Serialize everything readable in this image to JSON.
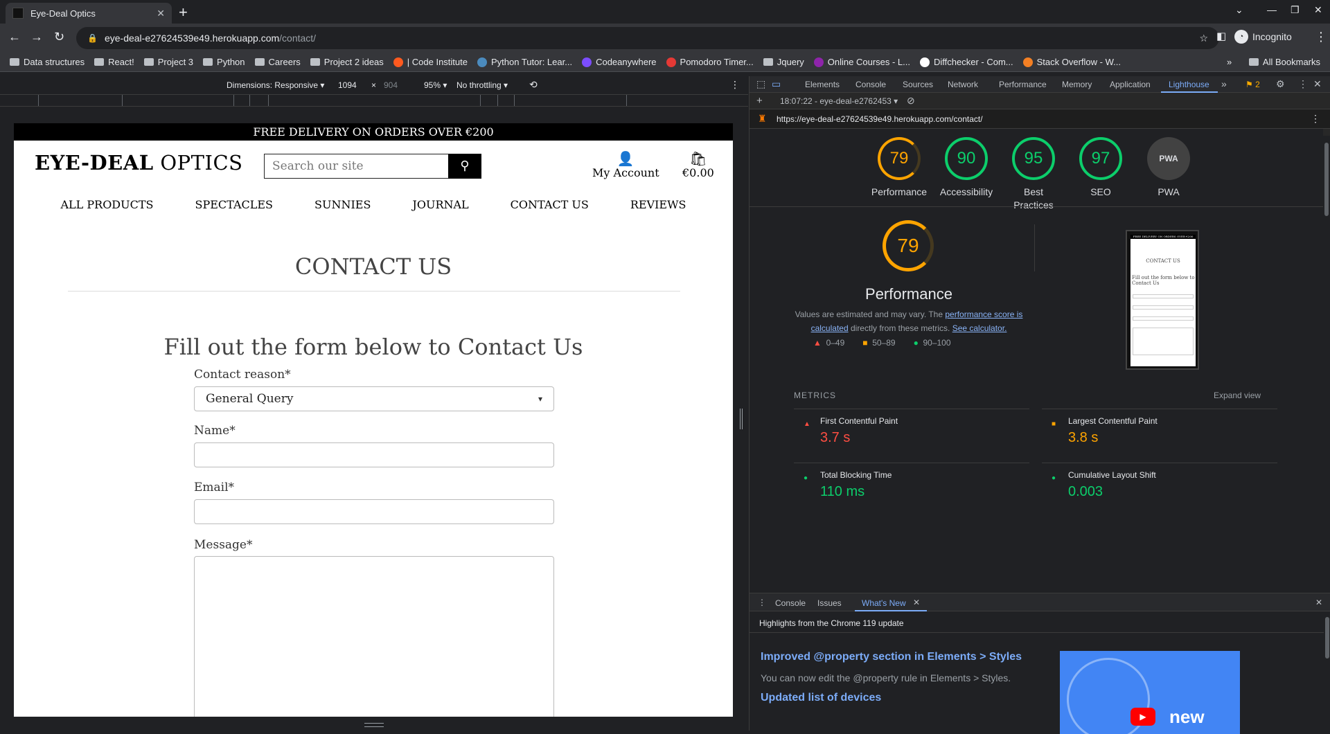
{
  "browser": {
    "tab_title": "Eye-Deal Optics",
    "new_tab": "+",
    "url_host": "eye-deal-e27624539e49.herokuapp.com",
    "url_path": "/contact/",
    "incognito_label": "Incognito",
    "bookmarks": [
      {
        "label": "Data structures",
        "icon": "folder-icon"
      },
      {
        "label": "React!",
        "icon": "folder-icon"
      },
      {
        "label": "Project 3",
        "icon": "folder-icon"
      },
      {
        "label": "Python",
        "icon": "folder-icon"
      },
      {
        "label": "Careers",
        "icon": "folder-icon"
      },
      {
        "label": "Project 2 ideas",
        "icon": "folder-icon"
      },
      {
        "label": "| Code Institute",
        "icon": "code-institute-icon"
      },
      {
        "label": "Python Tutor: Lear...",
        "icon": "python-icon"
      },
      {
        "label": "Codeanywhere",
        "icon": "codeanywhere-icon"
      },
      {
        "label": "Pomodoro Timer...",
        "icon": "pomodoro-icon"
      },
      {
        "label": "Jquery",
        "icon": "folder-icon"
      },
      {
        "label": "Online Courses - L...",
        "icon": "courses-icon"
      },
      {
        "label": "Diffchecker - Com...",
        "icon": "diffchecker-icon"
      },
      {
        "label": "Stack Overflow - W...",
        "icon": "stackoverflow-icon"
      }
    ],
    "all_bookmarks": "All Bookmarks"
  },
  "device_toolbar": {
    "dimensions": "Dimensions: Responsive",
    "width": "1094",
    "times": "×",
    "height": "904",
    "zoom": "95%",
    "throttling": "No throttling"
  },
  "site": {
    "promo": "FREE DELIVERY ON ORDERS OVER €200",
    "logo_bold": "EYE-DEAL",
    "logo_light": " OPTICS",
    "search_placeholder": "Search our site",
    "account": "My Account",
    "bag_total": "€0.00",
    "nav": [
      "ALL PRODUCTS",
      "SPECTACLES",
      "SUNNIES",
      "JOURNAL",
      "CONTACT US",
      "REVIEWS"
    ],
    "page_title": "CONTACT US",
    "form_title": "Fill out the form below to Contact Us",
    "contact_reason_label": "Contact reason*",
    "contact_reason_value": "General Query",
    "name_label": "Name*",
    "email_label": "Email*",
    "message_label": "Message*"
  },
  "devtools": {
    "tabs": [
      "Elements",
      "Console",
      "Sources",
      "Network",
      "Performance",
      "Memory",
      "Application",
      "Lighthouse"
    ],
    "more": "»",
    "issues_count": "2",
    "report_select": "18:07:22 - eye-deal-e2762453",
    "report_url": "https://eye-deal-e27624539e49.herokuapp.com/contact/",
    "scores": [
      {
        "label": "Performance",
        "value": "79",
        "status": "orange"
      },
      {
        "label": "Accessibility",
        "value": "90",
        "status": "green"
      },
      {
        "label": "Best Practices",
        "value": "95",
        "status": "green"
      },
      {
        "label": "SEO",
        "value": "97",
        "status": "green"
      },
      {
        "label": "PWA",
        "value": "PWA",
        "status": "gray"
      }
    ],
    "perf_score": "79",
    "perf_title": "Performance",
    "perf_note_1": "Values are estimated and may vary. The ",
    "perf_link_1": "performance score is calculated",
    "perf_note_2": " directly from these metrics. ",
    "perf_link_2": "See calculator.",
    "legend": [
      "0–49",
      "50–89",
      "90–100"
    ],
    "metrics_header": "METRICS",
    "expand_view": "Expand view",
    "metrics": [
      {
        "name": "First Contentful Paint",
        "value": "3.7 s",
        "color": "#ff4e42"
      },
      {
        "name": "Largest Contentful Paint",
        "value": "3.8 s",
        "color": "#ffa400"
      },
      {
        "name": "Total Blocking Time",
        "value": "110 ms",
        "color": "#0cce6b"
      },
      {
        "name": "Cumulative Layout Shift",
        "value": "0.003",
        "color": "#0cce6b"
      }
    ],
    "thumb": {
      "promo": "FREE DELIVERY ON ORDERS OVER €200",
      "title": "CONTACT US",
      "form_title": "Fill out the form below to Contact Us"
    },
    "drawer_tabs": [
      "Console",
      "Issues",
      "What's New"
    ],
    "whats_new_header": "Highlights from the Chrome 119 update",
    "wn_title_1": "Improved @property section in Elements > Styles",
    "wn_desc_1": "You can now edit the @property rule in Elements > Styles.",
    "wn_title_2": "Updated list of devices",
    "wn_badge": "new"
  },
  "colors": {
    "accent": "#7cacf8",
    "score_green": "#0cce6b",
    "score_orange": "#ffa400",
    "score_red": "#ff4e42"
  }
}
